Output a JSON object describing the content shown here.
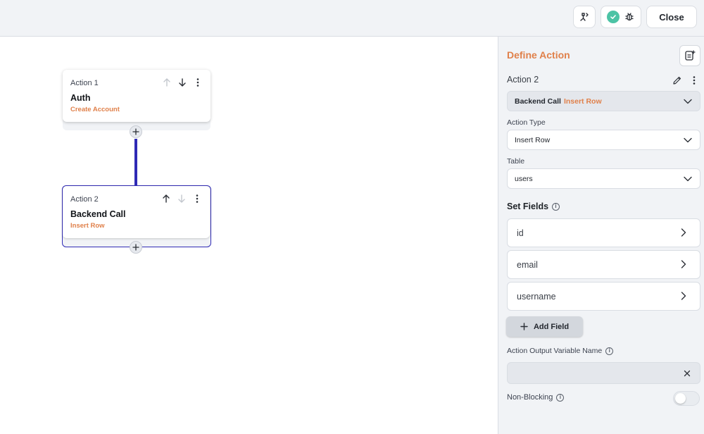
{
  "topbar": {
    "close_label": "Close",
    "icons": [
      "flow-tree-icon",
      "check-circle-icon",
      "bug-icon"
    ],
    "status_color": "#4cc3a5"
  },
  "canvas": {
    "accent_color": "#2f2ab5",
    "actions": [
      {
        "label": "Action 1",
        "title": "Auth",
        "subtitle": "Create Account",
        "selected": false
      },
      {
        "label": "Action 2",
        "title": "Backend Call",
        "subtitle": "Insert Row",
        "selected": true
      }
    ]
  },
  "panel": {
    "title": "Define Action",
    "action_name": "Action 2",
    "call_select": {
      "primary": "Backend Call",
      "secondary": "Insert Row"
    },
    "action_type": {
      "label": "Action Type",
      "value": "Insert Row"
    },
    "table": {
      "label": "Table",
      "value": "users"
    },
    "set_fields": {
      "label": "Set Fields",
      "fields": [
        "id",
        "email",
        "username"
      ]
    },
    "add_field_label": "Add Field",
    "output_var": {
      "label": "Action Output Variable Name",
      "value": ""
    },
    "non_blocking": {
      "label": "Non-Blocking",
      "enabled": false
    },
    "title_color": "#e0804a"
  }
}
